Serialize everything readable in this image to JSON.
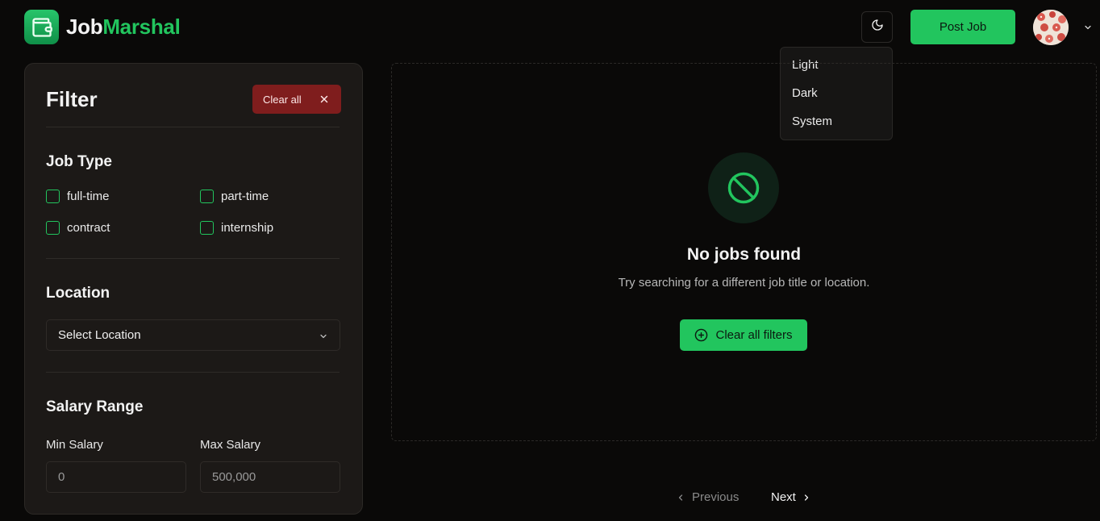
{
  "header": {
    "logo_first": "Job",
    "logo_second": "Marshal",
    "theme_icon": "moon-icon",
    "post_job_label": "Post Job",
    "avatar_icon": "avatar"
  },
  "theme_menu": {
    "items": [
      "Light",
      "Dark",
      "System"
    ]
  },
  "filter": {
    "title": "Filter",
    "clear_all_label": "Clear all",
    "job_type": {
      "title": "Job Type",
      "options": [
        "full-time",
        "part-time",
        "contract",
        "internship"
      ]
    },
    "location": {
      "title": "Location",
      "select_value": "Select Location"
    },
    "salary": {
      "title": "Salary Range",
      "min_label": "Min Salary",
      "min_placeholder": "0",
      "max_label": "Max Salary",
      "max_placeholder": "500,000"
    }
  },
  "main": {
    "empty_icon": "ban-icon",
    "empty_title": "No jobs found",
    "empty_subtitle": "Try searching for a different job title or location.",
    "clear_filters_label": "Clear all filters"
  },
  "pagination": {
    "previous_label": "Previous",
    "next_label": "Next"
  },
  "colors": {
    "accent": "#22c55e",
    "danger": "#7f1d1d",
    "background": "#0a0908",
    "panel": "#1c1917"
  }
}
